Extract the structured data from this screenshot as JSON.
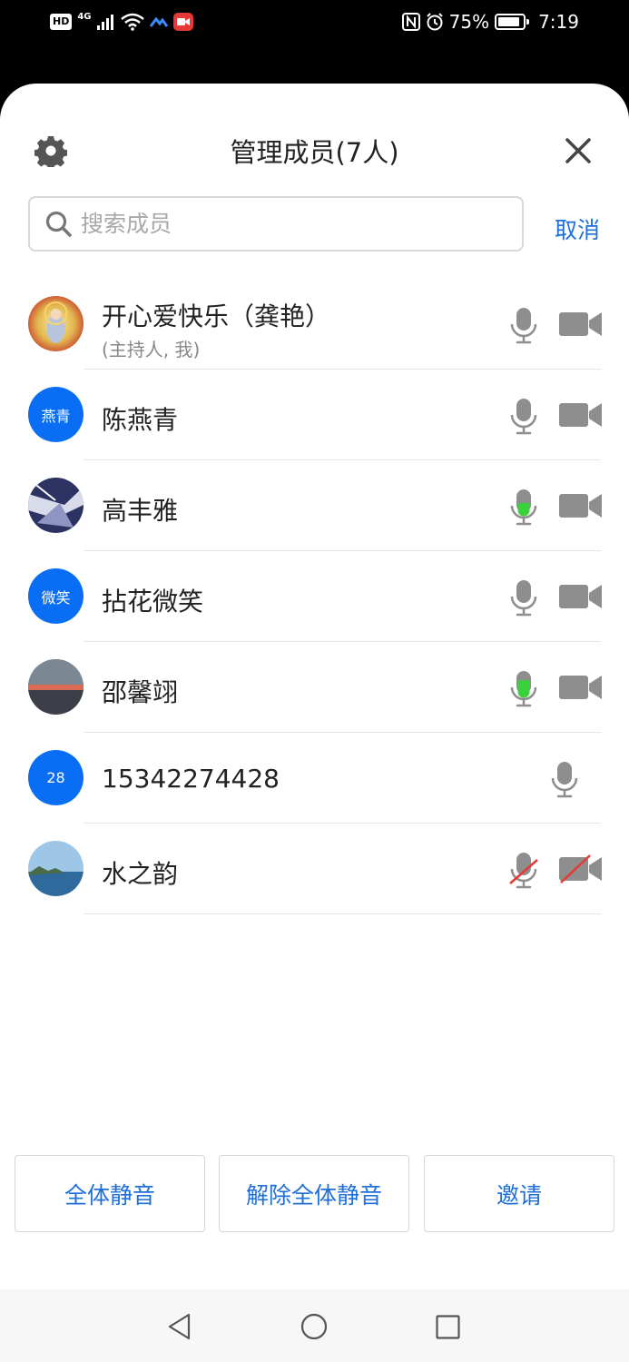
{
  "status_bar": {
    "hd": "HD",
    "network": "4G",
    "battery": "75%",
    "battery_level": 0.75,
    "time": "7:19"
  },
  "header": {
    "title": "管理成员(7人)",
    "settings_icon": "gear-icon",
    "close_icon": "close-icon"
  },
  "search": {
    "placeholder": "搜索成员",
    "cancel": "取消"
  },
  "members": [
    {
      "name": "开心爱快乐（龚艳）",
      "role": "(主持人, 我)",
      "avatar_text": "",
      "mic": "on",
      "cam": "on"
    },
    {
      "name": "陈燕青",
      "role": "",
      "avatar_text": "燕青",
      "mic": "on",
      "cam": "on"
    },
    {
      "name": "高丰雅",
      "role": "",
      "avatar_text": "",
      "mic": "speaking-low",
      "cam": "on"
    },
    {
      "name": "拈花微笑",
      "role": "",
      "avatar_text": "微笑",
      "mic": "on",
      "cam": "on"
    },
    {
      "name": "邵馨翊",
      "role": "",
      "avatar_text": "",
      "mic": "speaking",
      "cam": "on"
    },
    {
      "name": "15342274428",
      "role": "",
      "avatar_text": "28",
      "mic": "on",
      "cam": "none"
    },
    {
      "name": "水之韵",
      "role": "",
      "avatar_text": "",
      "mic": "muted",
      "cam": "off"
    }
  ],
  "actions": {
    "mute_all": "全体静音",
    "unmute_all": "解除全体静音",
    "invite": "邀请"
  },
  "colors": {
    "accent": "#1e6fd9",
    "avatar_blue": "#0a6ef5",
    "speaking_green": "#3ad13a",
    "muted_red": "#e53935",
    "icon_gray": "#8e8e8e"
  }
}
